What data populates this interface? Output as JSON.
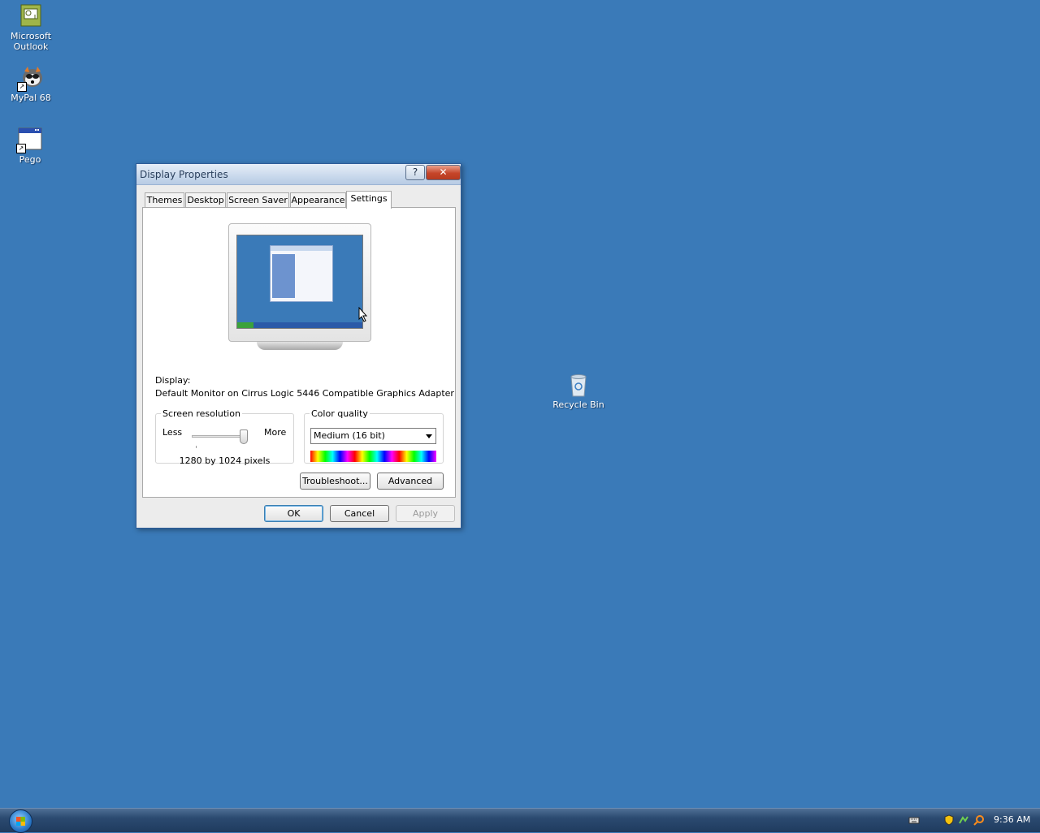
{
  "desktop": {
    "icons": [
      {
        "label": "Microsoft Outlook",
        "icon": "outlook-icon"
      },
      {
        "label": "MyPal 68",
        "icon": "mypal-browser-icon"
      },
      {
        "label": "Pego",
        "icon": "window-app-icon"
      },
      {
        "label": "Recycle Bin",
        "icon": "recycle-bin-icon"
      }
    ]
  },
  "dialog": {
    "title": "Display Properties",
    "help_label": "?",
    "close_label": "✕",
    "tabs": [
      {
        "label": "Themes",
        "active": false
      },
      {
        "label": "Desktop",
        "active": false
      },
      {
        "label": "Screen Saver",
        "active": false
      },
      {
        "label": "Appearance",
        "active": false
      },
      {
        "label": "Settings",
        "active": true
      }
    ],
    "display_label": "Display:",
    "display_value": "Default Monitor on Cirrus Logic 5446 Compatible Graphics Adapter",
    "resolution": {
      "legend": "Screen resolution",
      "less_label": "Less",
      "more_label": "More",
      "value_text": "1280 by 1024 pixels",
      "slider_fraction": 1.0
    },
    "color_quality": {
      "legend": "Color quality",
      "selected": "Medium (16 bit)"
    },
    "troubleshoot_label": "Troubleshoot...",
    "advanced_label": "Advanced",
    "ok_label": "OK",
    "cancel_label": "Cancel",
    "apply_label": "Apply",
    "apply_enabled": false
  },
  "taskbar": {
    "clock": "9:36 AM",
    "tray_icons": [
      "keyboard-icon",
      "security-shield-icon",
      "network-icon",
      "search-icon"
    ]
  },
  "colors": {
    "desktop": "#3a7ab8",
    "taskbar": "#2b4a70"
  }
}
